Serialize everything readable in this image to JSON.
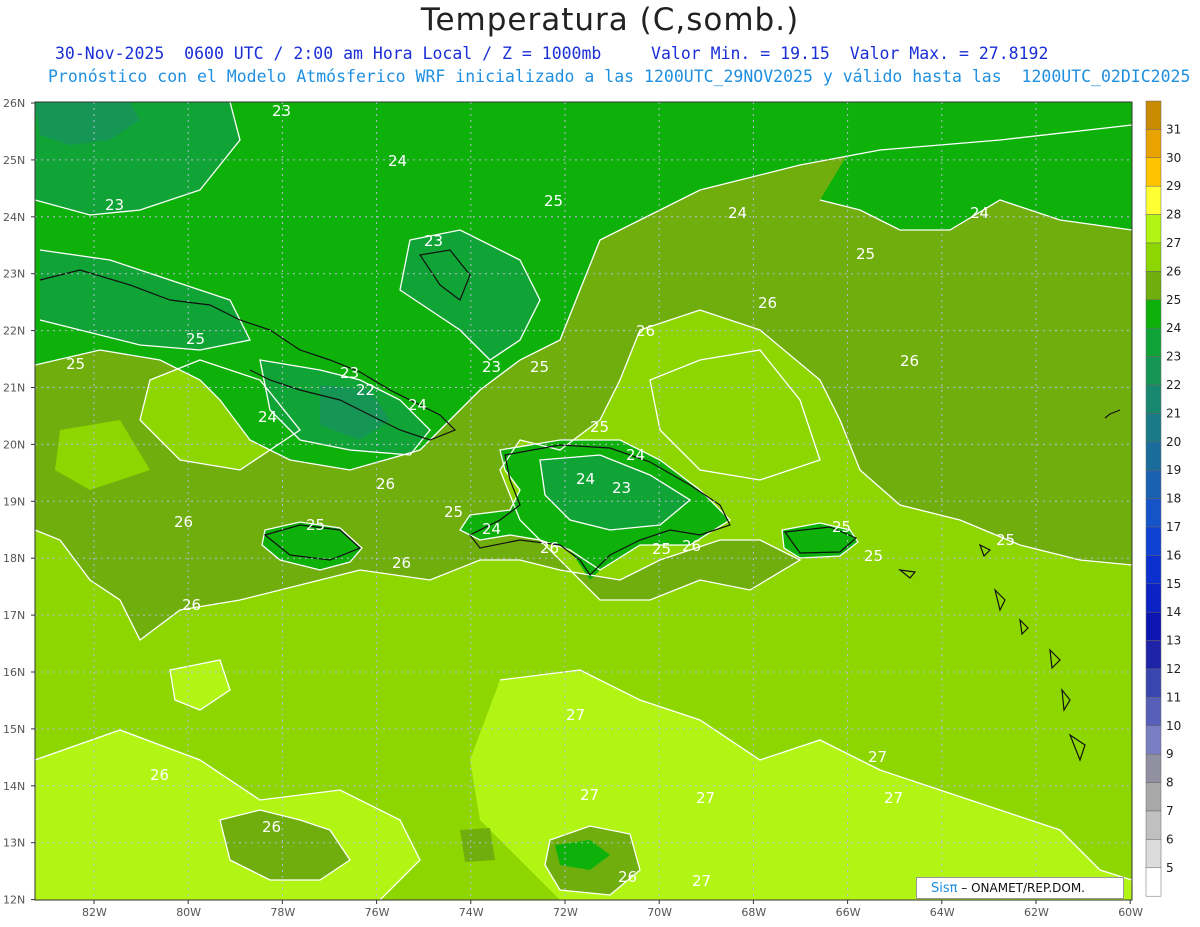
{
  "header": {
    "title": "Temperatura (C,somb.)",
    "line1": "30-Nov-2025  0600 UTC / 2:00 am Hora Local / Z = 1000mb     Valor Min. = 19.15  Valor Max. = 27.8192",
    "line2": "Pronóstico con el Modelo Atmósferico WRF inicializado a las 1200UTC_29NOV2025 y válido hasta las  1200UTC_02DIC2025"
  },
  "axes": {
    "lat_labels": [
      "26N",
      "25N",
      "24N",
      "23N",
      "22N",
      "21N",
      "20N",
      "19N",
      "18N",
      "17N",
      "16N",
      "15N",
      "14N",
      "13N",
      "12N"
    ],
    "lon_labels": [
      "82W",
      "80W",
      "78W",
      "76W",
      "74W",
      "72W",
      "70W",
      "68W",
      "66W",
      "64W",
      "62W",
      "60W"
    ]
  },
  "colorbar": {
    "levels": [
      {
        "v": "31",
        "c": "#c98a00"
      },
      {
        "v": "30",
        "c": "#e8a300"
      },
      {
        "v": "29",
        "c": "#ffc400"
      },
      {
        "v": "28",
        "c": "#ffff33"
      },
      {
        "v": "27",
        "c": "#b2f514"
      },
      {
        "v": "26",
        "c": "#8ed600"
      },
      {
        "v": "25",
        "c": "#6fae0c"
      },
      {
        "v": "24",
        "c": "#0db10a"
      },
      {
        "v": "23",
        "c": "#10a336"
      },
      {
        "v": "22",
        "c": "#169654"
      },
      {
        "v": "21",
        "c": "#17886e"
      },
      {
        "v": "20",
        "c": "#1a7a86"
      },
      {
        "v": "19",
        "c": "#1a6d9a"
      },
      {
        "v": "18",
        "c": "#1a62b1"
      },
      {
        "v": "17",
        "c": "#1554c8"
      },
      {
        "v": "16",
        "c": "#0f42d4"
      },
      {
        "v": "15",
        "c": "#0c30d0"
      },
      {
        "v": "14",
        "c": "#0b22c4"
      },
      {
        "v": "13",
        "c": "#0c14b2"
      },
      {
        "v": "12",
        "c": "#1f23a8"
      },
      {
        "v": "11",
        "c": "#3a46b0"
      },
      {
        "v": "10",
        "c": "#5760b8"
      },
      {
        "v": "9",
        "c": "#7a7ec2"
      },
      {
        "v": "8",
        "c": "#9090a0"
      },
      {
        "v": "7",
        "c": "#a8a8a8"
      },
      {
        "v": "6",
        "c": "#c0c0c0"
      },
      {
        "v": "5",
        "c": "#dcdcdc"
      },
      {
        "v": "",
        "c": "#ffffff"
      }
    ]
  },
  "contour_labels": [
    "23",
    "24",
    "23",
    "25",
    "24",
    "24",
    "23",
    "25",
    "25",
    "23",
    "25",
    "26",
    "22",
    "23",
    "24",
    "24",
    "25",
    "26",
    "25",
    "26",
    "24",
    "23",
    "24",
    "26",
    "25",
    "24",
    "25",
    "26",
    "25",
    "26",
    "25",
    "26",
    "26",
    "25",
    "26",
    "25",
    "26",
    "27",
    "27",
    "27",
    "27",
    "27",
    "26",
    "26",
    "27"
  ],
  "credit": {
    "logo_prefix": "Sis",
    "logo_pi": "π",
    "text": " – ONAMET/REP.DOM."
  }
}
